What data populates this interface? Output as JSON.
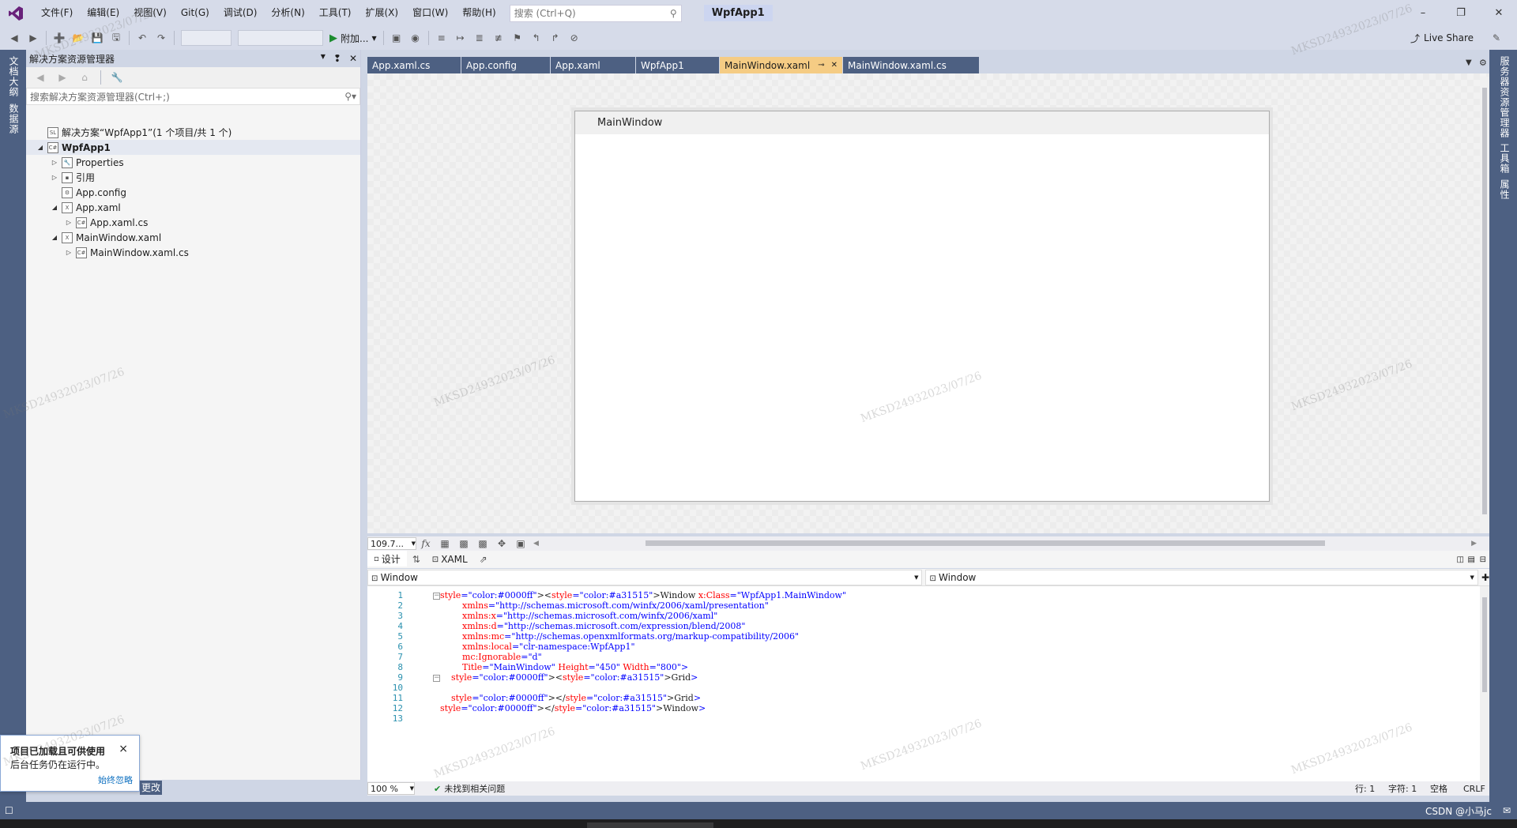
{
  "menu": [
    "文件(F)",
    "编辑(E)",
    "视图(V)",
    "Git(G)",
    "调试(D)",
    "分析(N)",
    "工具(T)",
    "扩展(X)",
    "窗口(W)",
    "帮助(H)"
  ],
  "search": {
    "placeholder": "搜索 (Ctrl+Q)"
  },
  "app_title": "WpfApp1",
  "toolbar": {
    "run_label": "附加...",
    "live_share": "Live Share"
  },
  "left_strip": {
    "tab1": "文档大纲",
    "tab2": "数据源"
  },
  "right_strip": {
    "tab1": "服务器资源管理器",
    "tab2": "工具箱",
    "tab3": "属性"
  },
  "solution_explorer": {
    "title": "解决方案资源管理器",
    "search_placeholder": "搜索解决方案资源管理器(Ctrl+;)",
    "tree": [
      {
        "label": "解决方案“WpfApp1”(1 个项目/共 1 个)"
      },
      {
        "label": "WpfApp1"
      },
      {
        "label": "Properties"
      },
      {
        "label": "引用"
      },
      {
        "label": "App.config"
      },
      {
        "label": "App.xaml"
      },
      {
        "label": "App.xaml.cs"
      },
      {
        "label": "MainWindow.xaml"
      },
      {
        "label": "MainWindow.xaml.cs"
      }
    ]
  },
  "notification": {
    "title": "项目已加载且可供使用",
    "body": "后台任务仍在运行中。",
    "link": "始终忽略",
    "close": "×",
    "peek": "更改"
  },
  "tabs": [
    "App.xaml.cs",
    "App.config",
    "App.xaml",
    "WpfApp1",
    "MainWindow.xaml",
    "MainWindow.xaml.cs"
  ],
  "active_tab": "MainWindow.xaml",
  "designer": {
    "window_title": "MainWindow",
    "zoom": "109.7...",
    "fx": "fx"
  },
  "viewbar": {
    "design": "设计",
    "xaml": "XAML"
  },
  "navbar": {
    "left": "Window",
    "right": "Window"
  },
  "code": {
    "line_numbers": [
      "1",
      "2",
      "3",
      "4",
      "5",
      "6",
      "7",
      "8",
      "9",
      "10",
      "11",
      "12",
      "13"
    ],
    "lines": [
      "<Window x:Class=\"WpfApp1.MainWindow\"",
      "        xmlns=\"http://schemas.microsoft.com/winfx/2006/xaml/presentation\"",
      "        xmlns:x=\"http://schemas.microsoft.com/winfx/2006/xaml\"",
      "        xmlns:d=\"http://schemas.microsoft.com/expression/blend/2008\"",
      "        xmlns:mc=\"http://schemas.openxmlformats.org/markup-compatibility/2006\"",
      "        xmlns:local=\"clr-namespace:WpfApp1\"",
      "        mc:Ignorable=\"d\"",
      "        Title=\"MainWindow\" Height=\"450\" Width=\"800\">",
      "    <Grid>",
      "",
      "    </Grid>",
      "</Window>",
      ""
    ]
  },
  "editor_status": {
    "zoom": "100 %",
    "issues": "未找到相关问题",
    "line": "行: 1",
    "char": "字符: 1",
    "space": "空格",
    "eol": "CRLF"
  },
  "statusbar": {
    "right": "CSDN @小马jc"
  },
  "watermark": "MKSD24932023/07/26",
  "colors": {
    "accent_tab": "#f5cc84",
    "chrome": "#4d6082",
    "keyword": "#a31515",
    "attr": "#ff0000",
    "value": "#0000ff"
  }
}
